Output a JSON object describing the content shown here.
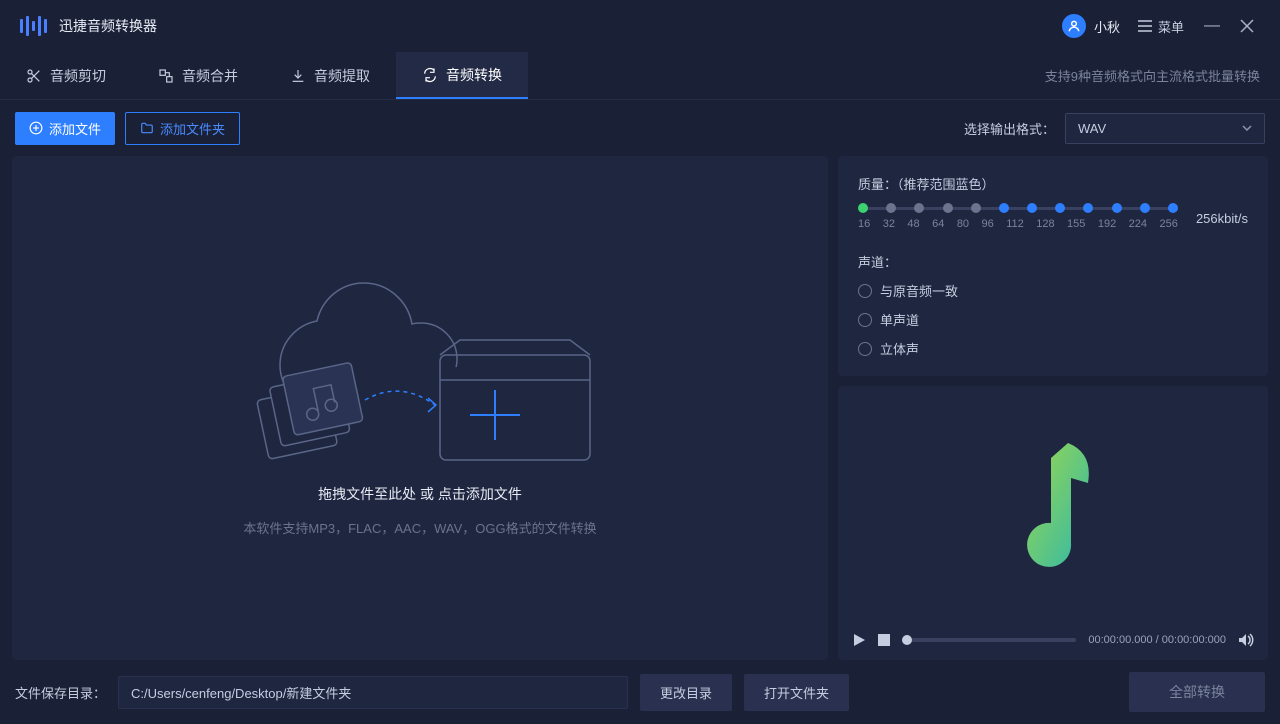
{
  "app": {
    "title": "迅捷音频转换器"
  },
  "user": {
    "name": "小秋"
  },
  "menu": {
    "label": "菜单"
  },
  "tabs": {
    "items": [
      {
        "label": "音频剪切"
      },
      {
        "label": "音频合并"
      },
      {
        "label": "音频提取"
      },
      {
        "label": "音频转换"
      }
    ],
    "hint": "支持9种音频格式向主流格式批量转换"
  },
  "toolbar": {
    "add_file": "添加文件",
    "add_folder": "添加文件夹",
    "format_label": "选择输出格式：",
    "format_value": "WAV"
  },
  "drop": {
    "main_text": "拖拽文件至此处 或 点击添加文件",
    "hint_text": "本软件支持MP3，FLAC，AAC，WAV，OGG格式的文件转换"
  },
  "quality": {
    "label": "质量：（推荐范围蓝色）",
    "ticks": [
      "16",
      "32",
      "48",
      "64",
      "80",
      "96",
      "112",
      "128",
      "155",
      "192",
      "224",
      "256"
    ],
    "bitrate": "256kbit/s",
    "blue_start_index": 5
  },
  "channel": {
    "label": "声道：",
    "options": [
      "与原音频一致",
      "单声道",
      "立体声"
    ]
  },
  "player": {
    "time": "00:00:00.000 / 00:00:00:000"
  },
  "footer": {
    "path_label": "文件保存目录：",
    "path_value": "C:/Users/cenfeng/Desktop/新建文件夹",
    "change_dir": "更改目录",
    "open_folder": "打开文件夹",
    "convert_all": "全部转换"
  }
}
